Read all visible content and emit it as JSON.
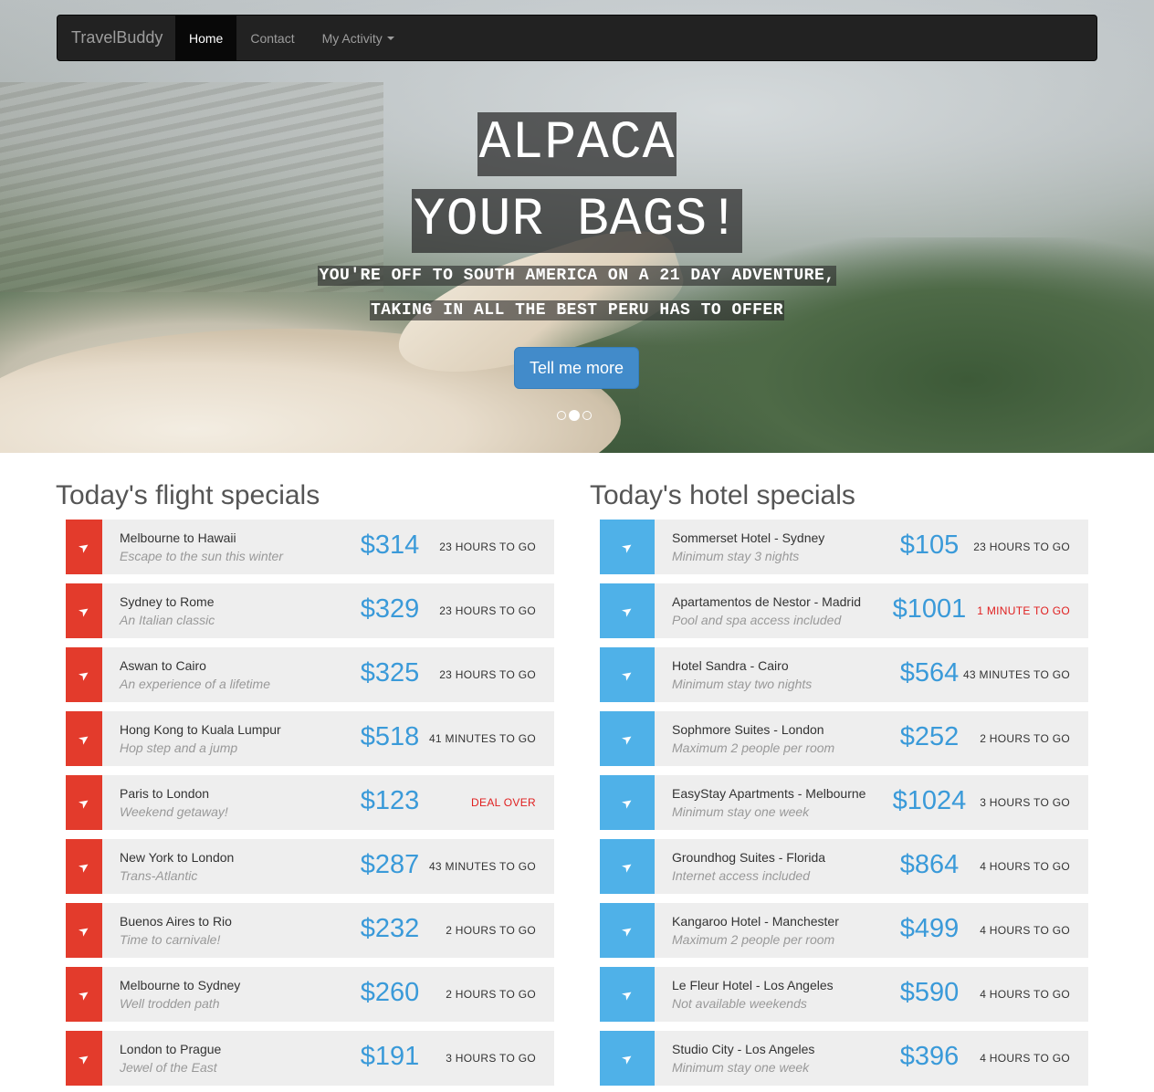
{
  "navbar": {
    "brand": "TravelBuddy",
    "items": [
      {
        "label": "Home",
        "active": true
      },
      {
        "label": "Contact",
        "active": false
      },
      {
        "label": "My Activity",
        "active": false
      }
    ]
  },
  "hero": {
    "headline_1": "ALPACA",
    "headline_2": "YOUR BAGS!",
    "subline_1": "YOU'RE OFF TO SOUTH AMERICA ON A 21 DAY ADVENTURE,",
    "subline_2": "TAKING IN ALL THE BEST PERU HAS TO OFFER",
    "cta_label": "Tell me more",
    "slides_count": 3,
    "active_slide": 2
  },
  "colors": {
    "flight_accent": "#e33b2c",
    "hotel_accent": "#4fb1e8",
    "price": "#3a9ad9",
    "urgent": "#e02020"
  },
  "flights": {
    "title": "Today's flight specials",
    "icon": "plane-icon",
    "items": [
      {
        "title": "Melbourne to Hawaii",
        "subtitle": "Escape to the sun this winter",
        "price": "$314",
        "timer": "23 HOURS TO GO",
        "urgent": false
      },
      {
        "title": "Sydney to Rome",
        "subtitle": "An Italian classic",
        "price": "$329",
        "timer": "23 HOURS TO GO",
        "urgent": false
      },
      {
        "title": "Aswan to Cairo",
        "subtitle": "An experience of a lifetime",
        "price": "$325",
        "timer": "23 HOURS TO GO",
        "urgent": false
      },
      {
        "title": "Hong Kong to Kuala Lumpur",
        "subtitle": "Hop step and a jump",
        "price": "$518",
        "timer": "41 MINUTES TO GO",
        "urgent": false
      },
      {
        "title": "Paris to London",
        "subtitle": "Weekend getaway!",
        "price": "$123",
        "timer": "DEAL OVER",
        "urgent": true
      },
      {
        "title": "New York to London",
        "subtitle": "Trans-Atlantic",
        "price": "$287",
        "timer": "43 MINUTES TO GO",
        "urgent": false
      },
      {
        "title": "Buenos Aires to Rio",
        "subtitle": "Time to carnivale!",
        "price": "$232",
        "timer": "2 HOURS TO GO",
        "urgent": false
      },
      {
        "title": "Melbourne to Sydney",
        "subtitle": "Well trodden path",
        "price": "$260",
        "timer": "2 HOURS TO GO",
        "urgent": false
      },
      {
        "title": "London to Prague",
        "subtitle": "Jewel of the East",
        "price": "$191",
        "timer": "3 HOURS TO GO",
        "urgent": false
      }
    ]
  },
  "hotels": {
    "title": "Today's hotel specials",
    "icon": "plane-icon",
    "items": [
      {
        "title": "Sommerset Hotel - Sydney",
        "subtitle": "Minimum stay 3 nights",
        "price": "$105",
        "timer": "23 HOURS TO GO",
        "urgent": false
      },
      {
        "title": "Apartamentos de Nestor - Madrid",
        "subtitle": "Pool and spa access included",
        "price": "$1001",
        "timer": "1 MINUTE TO GO",
        "urgent": true
      },
      {
        "title": "Hotel Sandra - Cairo",
        "subtitle": "Minimum stay two nights",
        "price": "$564",
        "timer": "43 MINUTES TO GO",
        "urgent": false
      },
      {
        "title": "Sophmore Suites - London",
        "subtitle": "Maximum 2 people per room",
        "price": "$252",
        "timer": "2 HOURS TO GO",
        "urgent": false
      },
      {
        "title": "EasyStay Apartments - Melbourne",
        "subtitle": "Minimum stay one week",
        "price": "$1024",
        "timer": "3 HOURS TO GO",
        "urgent": false
      },
      {
        "title": "Groundhog Suites - Florida",
        "subtitle": "Internet access included",
        "price": "$864",
        "timer": "4 HOURS TO GO",
        "urgent": false
      },
      {
        "title": "Kangaroo Hotel - Manchester",
        "subtitle": "Maximum 2 people per room",
        "price": "$499",
        "timer": "4 HOURS TO GO",
        "urgent": false
      },
      {
        "title": "Le Fleur Hotel - Los Angeles",
        "subtitle": "Not available weekends",
        "price": "$590",
        "timer": "4 HOURS TO GO",
        "urgent": false
      },
      {
        "title": "Studio City - Los Angeles",
        "subtitle": "Minimum stay one week",
        "price": "$396",
        "timer": "4 HOURS TO GO",
        "urgent": false
      }
    ]
  }
}
